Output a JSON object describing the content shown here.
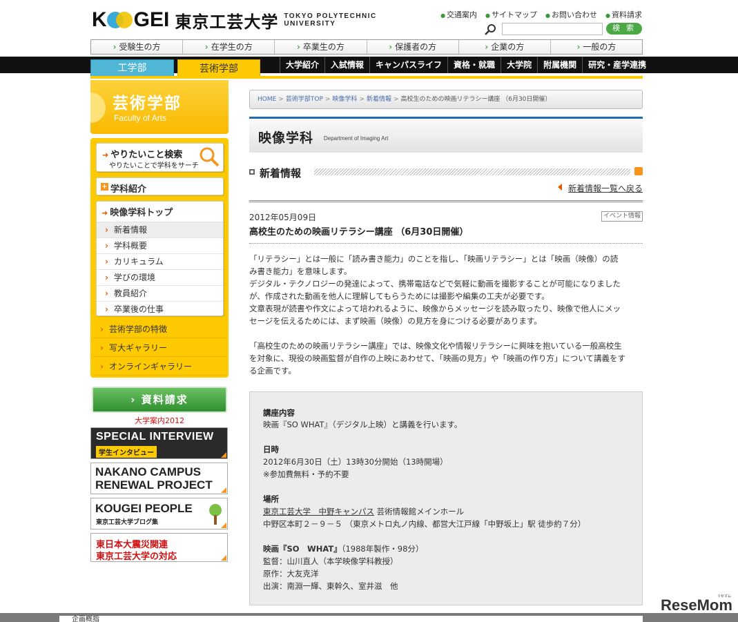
{
  "header": {
    "logo_en": "KOGEI",
    "logo_jp": "東京工芸大学",
    "logo_sub1": "TOKYO POLYTECHNIC",
    "logo_sub2": "UNIVERSITY",
    "top_links": [
      "交通案内",
      "サイトマップ",
      "お問い合わせ",
      "資料請求"
    ],
    "search_button": "検 索",
    "search_value": ""
  },
  "audience_nav": [
    "受験生の方",
    "在学生の方",
    "卒業生の方",
    "保護者の方",
    "企業の方",
    "一般の方"
  ],
  "faculty_tabs": {
    "engineering": "工学部",
    "arts": "芸術学部"
  },
  "main_nav": [
    "大学紹介",
    "入試情報",
    "キャンパスライフ",
    "資格・就職",
    "大学院",
    "附属機関",
    "研究・産学連携"
  ],
  "sidebar": {
    "faculty_jp": "芸術学部",
    "faculty_en": "Faculty of Arts",
    "find_title": "やりたいこと検索",
    "find_sub": "やりたいことで学科をサーチ",
    "dept_intro": "学科紹介",
    "dept_top": "映像学科トップ",
    "dept_sub": [
      "新着情報",
      "学科概要",
      "カリキュラム",
      "学びの環境",
      "教員紹介",
      "卒業後の仕事"
    ],
    "yellow_links": [
      "芸術学部の特徴",
      "写大ギャラリー",
      "オンラインギャラリー"
    ],
    "request_button": "資料請求",
    "request_sub": "大学案内2012",
    "banners": {
      "special_l1": "SPECIAL INTERVIEW",
      "special_l2": "学生インタビュー",
      "nakano_l1": "NAKANO CAMPUS",
      "nakano_l2": "RENEWAL PROJECT",
      "kougei_l1": "KOUGEI PEOPLE",
      "kougei_l2": "東京工芸大学ブログ集",
      "quake_l1": "東日本大震災関連",
      "quake_l2": "東京工芸大学の対応"
    }
  },
  "breadcrumb": {
    "items": [
      "HOME",
      "芸術学部TOP",
      "映像学科",
      "新着情報"
    ],
    "current": "高校生のための映画リテラシー講座 （6月30日開催）"
  },
  "department": {
    "title_jp": "映像学科",
    "title_en": "Department of Imaging Art"
  },
  "news": {
    "heading": "新着情報",
    "back_link": "新着情報一覧へ戻る",
    "date": "2012年05月09日",
    "tag": "イベント情報",
    "title": "高校生のための映画リテラシー講座 （6月30日開催）",
    "p1": [
      "「リテラシー」とは一般に「読み書き能力」のことを指し、「映画リテラシー」とは「映画（映像）の読",
      "み書き能力」を意味します。",
      "デジタル・テクノロジーの発達によって、携帯電話などで気軽に動画を撮影することが可能になりました",
      "が、作成された動画を他人に理解してもらうためには撮影や編集の工夫が必要です。",
      "文章表現が読書や作文によって培われるように、映像からメッセージを読み取ったり、映像で他人にメッ",
      "セージを伝えるためには、まず映画（映像）の見方を身につける必要があります。"
    ],
    "p2": [
      "「高校生のための映画リテラシー講座」では、映像文化や情報リテラシーに興味を抱いている一般高校生",
      "を対象に、現役の映画監督が自作の上映にあわせて、「映画の見方」や「映画の作り方」について講義をす",
      "る企画です。"
    ]
  },
  "info": {
    "content_h": "講座内容",
    "content_t": "映画『SO WHAT』（デジタル上映）と講義を行います。",
    "date_h": "日時",
    "date_t1": "2012年6月30日（土）13時30分開始（13時開場）",
    "date_t2": "※参加費無料・予約不要",
    "place_h": "場所",
    "place_link": "東京工芸大学　中野キャンパス",
    "place_t1": " 芸術情報館メインホール",
    "place_t2": "中野区本町２－９－５ （東京メトロ丸ノ内線、都営大江戸線「中野坂上」駅 徒歩約７分）",
    "film_h": "映画『SO　WHAT』",
    "film_meta": "（1988年製作・98分）",
    "film_director": "監督：山川直人（本学映像学科教授）",
    "film_original": "原作：大友克洋",
    "film_cast": "出演：南淵一輝、東幹久、室井滋　他"
  },
  "footer": {
    "text": "企画概指"
  },
  "watermark": {
    "text": "ReseMom",
    "small": "リセマム"
  }
}
